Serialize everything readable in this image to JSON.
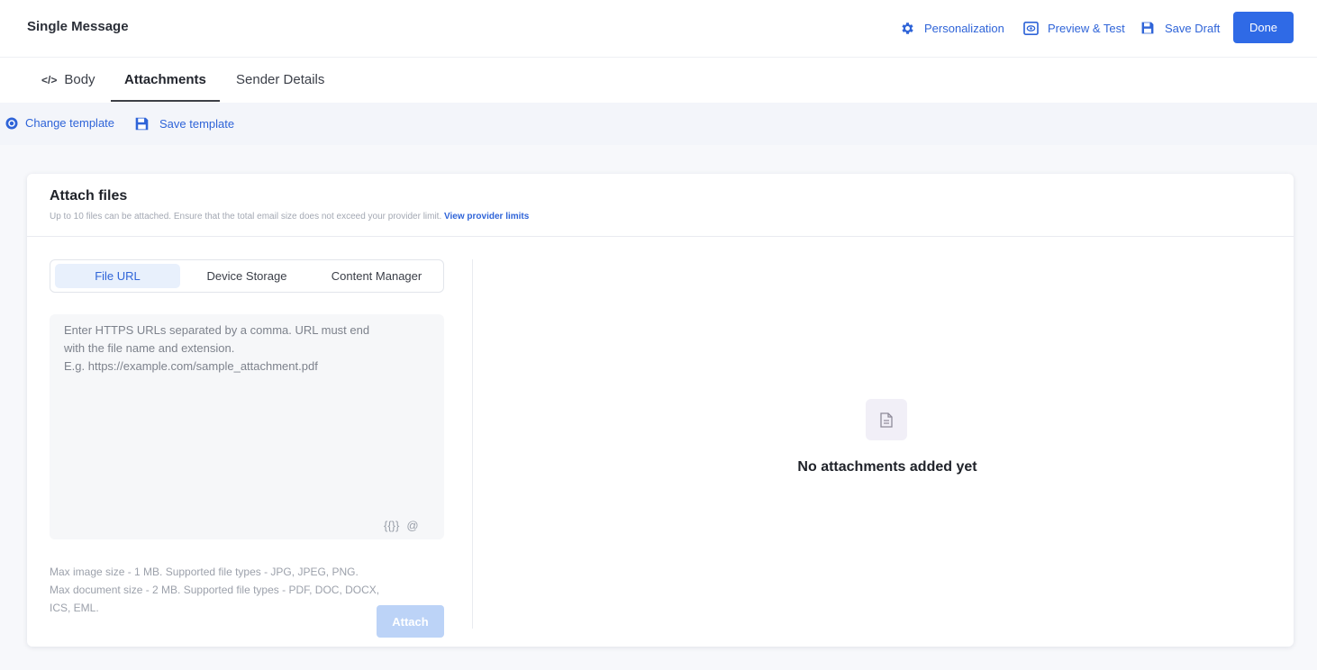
{
  "header": {
    "title": "Single Message",
    "personalization_label": "Personalization",
    "preview_label": "Preview & Test",
    "save_draft_label": "Save Draft",
    "done_label": "Done"
  },
  "tabs": [
    {
      "label": "Body",
      "icon": "code-icon"
    },
    {
      "label": "Attachments",
      "active": true
    },
    {
      "label": "Sender Details"
    }
  ],
  "template_bar": {
    "change_label": "Change template",
    "save_label": "Save template"
  },
  "attach": {
    "title": "Attach files",
    "subtitle": "Up to 10 files can be attached. Ensure that the total email size does not exceed your provider limit.",
    "link": "View provider limits",
    "sources": [
      "File URL",
      "Device Storage",
      "Content Manager"
    ],
    "active_source": "File URL",
    "placeholder": "Enter HTTPS URLs separated by a comma. URL must end\nwith the file name and extension.\nE.g. https://example.com/sample_attachment.pdf",
    "value": "",
    "icon_braces": "{{}}",
    "icon_at": "@",
    "hint_line1": "Max image size - 1 MB. Supported file types - JPG, JPEG, PNG.",
    "hint_line2": "Max document size - 2 MB. Supported file types - PDF, DOC, DOCX,",
    "hint_line3": "ICS, EML.",
    "attach_label": "Attach"
  },
  "empty_state": {
    "icon": "document-icon",
    "text": "No attachments added yet"
  },
  "colors": {
    "accent": "#2f6ae6",
    "link": "#2f64d8",
    "attach_disabled": "#bcd3f7"
  }
}
